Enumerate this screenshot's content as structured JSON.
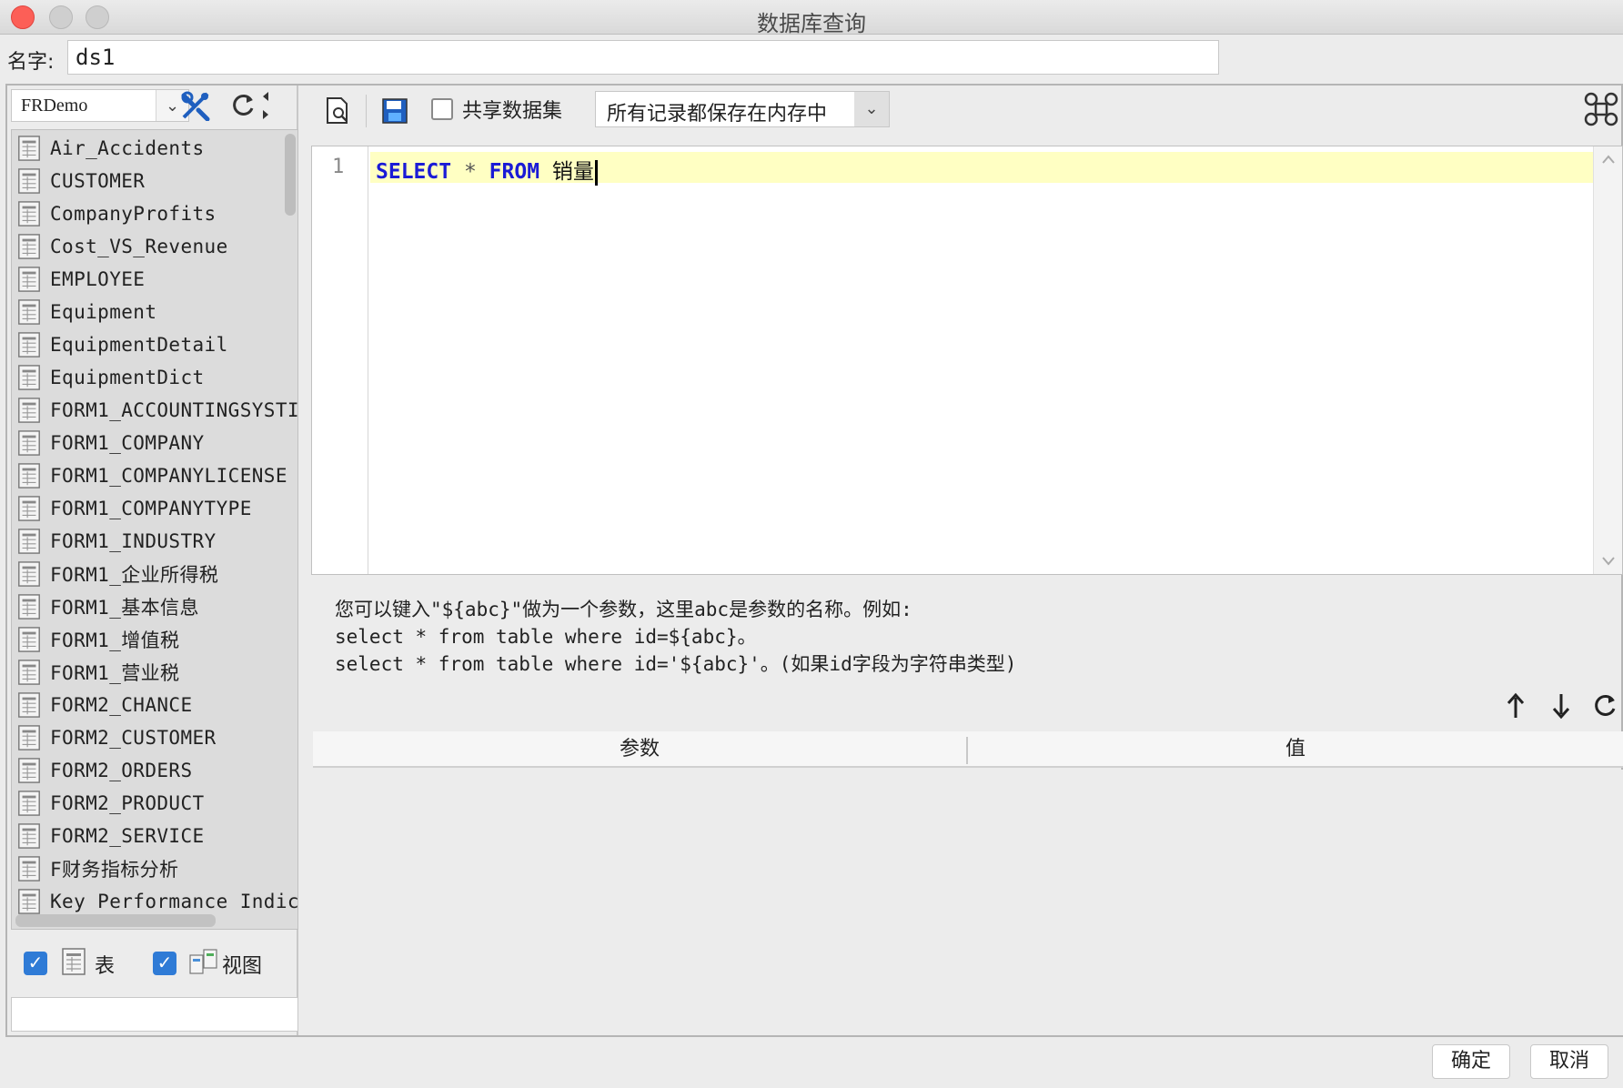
{
  "window": {
    "title": "数据库查询"
  },
  "name_row": {
    "label": "名字:",
    "value": "ds1"
  },
  "left": {
    "db_selected": "FRDemo",
    "tables": [
      "Air_Accidents",
      "CUSTOMER",
      "CompanyProfits",
      "Cost_VS_Revenue",
      "EMPLOYEE",
      "Equipment",
      "EquipmentDetail",
      "EquipmentDict",
      "FORM1_ACCOUNTINGSYSTI",
      "FORM1_COMPANY",
      "FORM1_COMPANYLICENSE",
      "FORM1_COMPANYTYPE",
      "FORM1_INDUSTRY",
      "FORM1_企业所得税",
      "FORM1_基本信息",
      "FORM1_增值税",
      "FORM1_营业税",
      "FORM2_CHANCE",
      "FORM2_CUSTOMER",
      "FORM2_ORDERS",
      "FORM2_PRODUCT",
      "FORM2_SERVICE",
      "F财务指标分析",
      "Key Performance Indic:"
    ],
    "filters": {
      "table_label": "表",
      "view_label": "视图"
    }
  },
  "toolbar": {
    "share_label": "共享数据集",
    "memory_option": "所有记录都保存在内存中"
  },
  "editor": {
    "line_number": "1",
    "kw_select": "SELECT",
    "star": "*",
    "kw_from": "FROM",
    "table": "销量"
  },
  "hint": {
    "line1": "您可以键入\"${abc}\"做为一个参数，这里abc是参数的名称。例如:",
    "line2": "select * from table where id=${abc}。",
    "line3": "select * from table where id='${abc}'。(如果id字段为字符串类型)"
  },
  "params": {
    "col_param": "参数",
    "col_value": "值"
  },
  "buttons": {
    "ok": "确定",
    "cancel": "取消"
  },
  "colors": {
    "accent": "#2f7bd6",
    "keyword": "#1b1bd6",
    "highlight": "#ffffc3"
  }
}
